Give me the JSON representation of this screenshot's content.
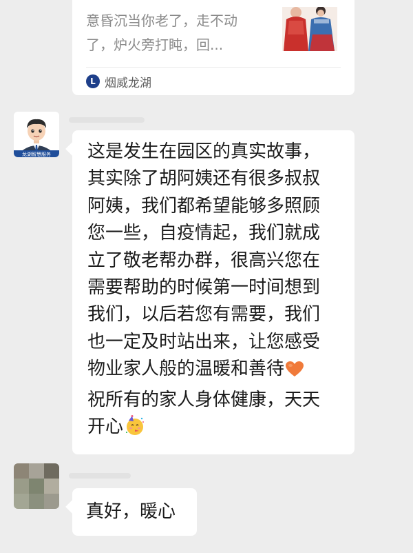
{
  "shared_card": {
    "description_line1": "意昏沉当你老了，走不动",
    "description_line2": "了，炉火旁打盹，回...",
    "thumbnail_icon": "elderly-couple-illustration",
    "source_logo_letter": "L",
    "source_name": "烟威龙湖"
  },
  "messages": [
    {
      "sender_avatar": "property-service-avatar",
      "avatar_caption": "龙湖智慧服务",
      "text": "这是发生在园区的真实故事，\n其实除了胡阿姨还有很多叔叔\n阿姨，我们都希望能够多照顾\n您一些，自疫情起，我们就成\n立了敬老帮办群，很高兴您在\n需要帮助的时候第一时间想到\n我们，以后若您有需要，我们\n也一定及时站出来，让您感受\n物业家人般的温暖和善待",
      "heart_emoji": "orange-heart-icon",
      "text_end": "祝所有的家人身体健康，天天\n开心",
      "party_emoji": "partying-face-icon"
    },
    {
      "sender_avatar": "blurred-user-avatar",
      "text": "真好，暖心"
    }
  ],
  "colors": {
    "background": "#ededed",
    "bubble": "#ffffff",
    "text": "#1b1b1b",
    "secondary_text": "#8a8a8a",
    "source_logo": "#1e3f8a",
    "heart": "#f07a3a"
  }
}
